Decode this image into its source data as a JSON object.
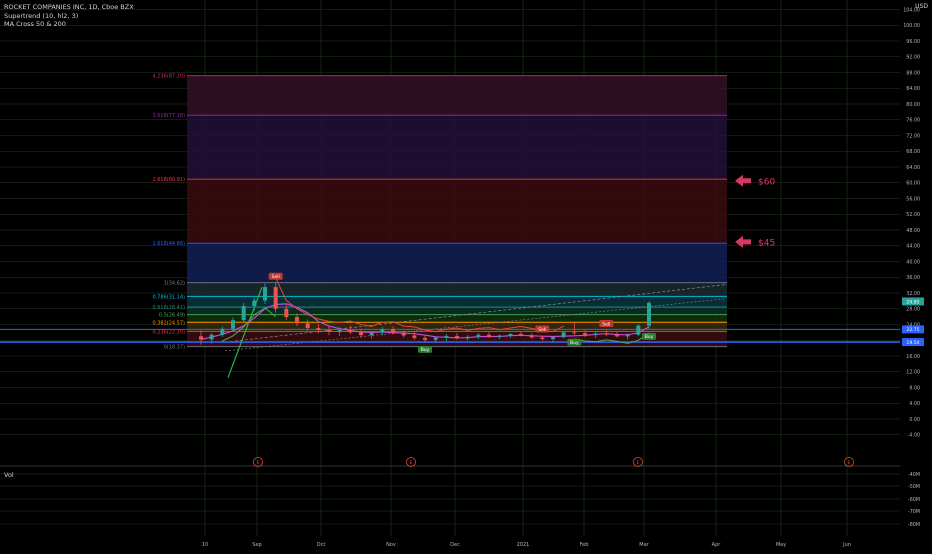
{
  "legend": {
    "symbol": "ROCKET COMPANIES INC, 1D, Cboe BZX",
    "indicator1": "Supertrend (10, hl2, 3)",
    "indicator2": "MA Cross 50 & 200",
    "vol": "Vol"
  },
  "currency": "USD",
  "colors": {
    "background": "#000000",
    "grid": "#1f3d1f",
    "up": "#26a69a",
    "down": "#ef5350",
    "annotation": "#d63864",
    "supertrend_up": "#4caf50",
    "supertrend_down": "#e04a3a",
    "ma": "#c04bd9"
  },
  "chart_data": {
    "type": "candlestick",
    "x_ticks": [
      "10",
      "Sep",
      "Oct",
      "Nov",
      "Dec",
      "2021",
      "Feb",
      "Mar",
      "Apr",
      "May",
      "Jun"
    ],
    "y_ticks": [
      "-4.00",
      "0.00",
      "4.00",
      "8.00",
      "12.00",
      "16.00",
      "20.00",
      "24.00",
      "28.00",
      "32.00",
      "36.00",
      "40.00",
      "44.00",
      "48.00",
      "52.00",
      "56.00",
      "60.00",
      "64.00",
      "68.00",
      "72.00",
      "76.00",
      "80.00",
      "84.00",
      "88.00",
      "92.00",
      "96.00",
      "100.00",
      "104.00",
      "108.00"
    ],
    "ylim": [
      -8,
      110
    ],
    "vol_ticks": [
      "-40M",
      "-50M",
      "-60M",
      "-70M",
      "-80M"
    ],
    "fib_levels": [
      {
        "label": "0(18.37)",
        "value": 18.37,
        "color": "#787b86"
      },
      {
        "label": "0.236(22.20)",
        "value": 22.2,
        "color": "#f23645"
      },
      {
        "label": "0.382(24.57)",
        "value": 24.57,
        "color": "#ff9800"
      },
      {
        "label": "0.5(26.49)",
        "value": 26.49,
        "color": "#4caf50"
      },
      {
        "label": "0.618(28.41)",
        "value": 28.41,
        "color": "#089981"
      },
      {
        "label": "0.786(31.14)",
        "value": 31.14,
        "color": "#00bcd4"
      },
      {
        "label": "1(34.62)",
        "value": 34.62,
        "color": "#787b86"
      },
      {
        "label": "1.618(44.66)",
        "value": 44.66,
        "color": "#2962ff"
      },
      {
        "label": "2.618(60.91)",
        "value": 60.91,
        "color": "#f23645"
      },
      {
        "label": "3.618(77.16)",
        "value": 77.16,
        "color": "#9c27b0"
      },
      {
        "label": "4.236(87.20)",
        "value": 87.2,
        "color": "#e91e63"
      }
    ],
    "annotations": [
      {
        "text": "$60",
        "value": 60.5
      },
      {
        "text": "$45",
        "value": 45
      }
    ],
    "price_labels": [
      "29.85",
      "22.75",
      "19.54"
    ],
    "signals": [
      {
        "text": "Sell",
        "kind": "sell"
      },
      {
        "text": "Buy",
        "kind": "buy"
      },
      {
        "text": "Sell",
        "kind": "sell"
      },
      {
        "text": "Buy",
        "kind": "buy"
      },
      {
        "text": "Sell",
        "kind": "sell"
      },
      {
        "text": "Buy",
        "kind": "buy"
      }
    ],
    "earnings_markers": [
      "E",
      "E",
      "E",
      "E"
    ],
    "candles": [
      {
        "o": 21.0,
        "h": 22.5,
        "l": 18.9,
        "c": 20.2
      },
      {
        "o": 20.2,
        "h": 21.8,
        "l": 19.2,
        "c": 21.4
      },
      {
        "o": 21.4,
        "h": 23.5,
        "l": 20.8,
        "c": 22.9
      },
      {
        "o": 22.9,
        "h": 25.8,
        "l": 22.1,
        "c": 25.1
      },
      {
        "o": 25.1,
        "h": 29.5,
        "l": 24.4,
        "c": 28.7
      },
      {
        "o": 28.7,
        "h": 30.8,
        "l": 27.5,
        "c": 30.1
      },
      {
        "o": 30.1,
        "h": 34.4,
        "l": 29.2,
        "c": 33.5
      },
      {
        "o": 33.5,
        "h": 34.6,
        "l": 27.0,
        "c": 28.0
      },
      {
        "o": 28.0,
        "h": 28.9,
        "l": 25.2,
        "c": 25.9
      },
      {
        "o": 25.9,
        "h": 26.8,
        "l": 23.6,
        "c": 24.3
      },
      {
        "o": 24.3,
        "h": 25.3,
        "l": 22.4,
        "c": 23.1
      },
      {
        "o": 23.1,
        "h": 24.2,
        "l": 21.7,
        "c": 22.6
      },
      {
        "o": 22.6,
        "h": 23.6,
        "l": 21.3,
        "c": 22.1
      },
      {
        "o": 22.1,
        "h": 23.3,
        "l": 21.1,
        "c": 22.6
      },
      {
        "o": 22.6,
        "h": 23.7,
        "l": 21.6,
        "c": 22.0
      },
      {
        "o": 22.0,
        "h": 22.8,
        "l": 20.6,
        "c": 21.3
      },
      {
        "o": 21.3,
        "h": 22.3,
        "l": 20.4,
        "c": 21.9
      },
      {
        "o": 21.9,
        "h": 23.4,
        "l": 21.2,
        "c": 22.8
      },
      {
        "o": 22.8,
        "h": 23.5,
        "l": 21.5,
        "c": 21.8
      },
      {
        "o": 21.8,
        "h": 22.4,
        "l": 20.7,
        "c": 21.2
      },
      {
        "o": 21.2,
        "h": 22.2,
        "l": 20.1,
        "c": 20.6
      },
      {
        "o": 20.6,
        "h": 21.4,
        "l": 19.6,
        "c": 20.1
      },
      {
        "o": 20.1,
        "h": 21.0,
        "l": 19.3,
        "c": 20.7
      },
      {
        "o": 20.7,
        "h": 21.6,
        "l": 19.8,
        "c": 21.1
      },
      {
        "o": 21.1,
        "h": 21.9,
        "l": 20.2,
        "c": 20.5
      },
      {
        "o": 20.5,
        "h": 21.3,
        "l": 19.9,
        "c": 20.9
      },
      {
        "o": 20.9,
        "h": 21.8,
        "l": 20.3,
        "c": 21.4
      },
      {
        "o": 21.4,
        "h": 22.0,
        "l": 20.6,
        "c": 20.8
      },
      {
        "o": 20.8,
        "h": 21.5,
        "l": 20.2,
        "c": 21.2
      },
      {
        "o": 21.2,
        "h": 21.9,
        "l": 20.6,
        "c": 21.6
      },
      {
        "o": 21.6,
        "h": 22.3,
        "l": 21.0,
        "c": 21.3
      },
      {
        "o": 21.3,
        "h": 21.8,
        "l": 20.4,
        "c": 20.7
      },
      {
        "o": 20.7,
        "h": 21.2,
        "l": 19.9,
        "c": 20.3
      },
      {
        "o": 20.3,
        "h": 21.0,
        "l": 19.7,
        "c": 20.8
      },
      {
        "o": 20.8,
        "h": 22.4,
        "l": 20.5,
        "c": 22.0
      },
      {
        "o": 22.0,
        "h": 24.6,
        "l": 21.4,
        "c": 21.8
      },
      {
        "o": 21.8,
        "h": 22.5,
        "l": 20.8,
        "c": 21.3
      },
      {
        "o": 21.3,
        "h": 22.1,
        "l": 20.6,
        "c": 21.7
      },
      {
        "o": 21.7,
        "h": 22.6,
        "l": 21.1,
        "c": 21.5
      },
      {
        "o": 21.5,
        "h": 22.2,
        "l": 20.7,
        "c": 21.0
      },
      {
        "o": 21.0,
        "h": 21.8,
        "l": 20.2,
        "c": 21.4
      },
      {
        "o": 21.4,
        "h": 24.1,
        "l": 21.0,
        "c": 23.7
      },
      {
        "o": 23.7,
        "h": 29.9,
        "l": 22.9,
        "c": 29.5
      }
    ]
  }
}
